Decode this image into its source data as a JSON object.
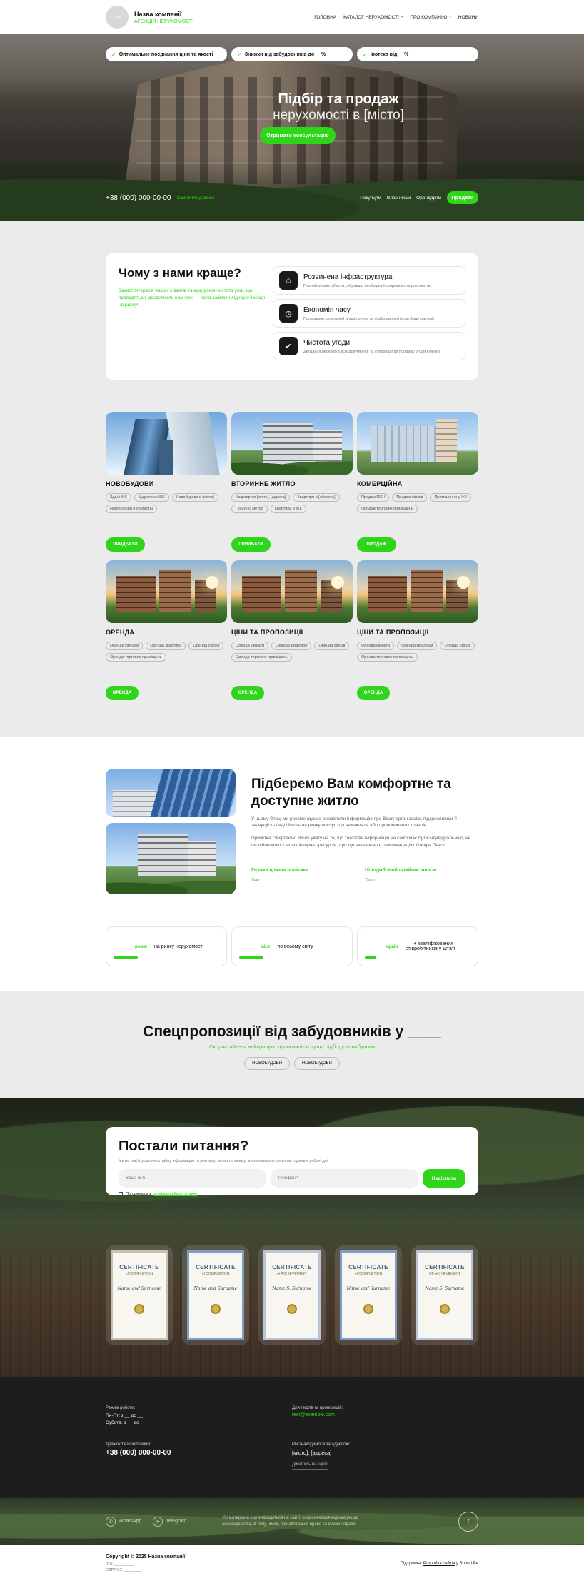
{
  "header": {
    "logo_text": "лого",
    "company": "Назва компанії",
    "subtitle": "АГЕНЦІЯ НЕРУХОМОСТІ",
    "nav": [
      {
        "label": "ГОЛОВНА",
        "chevron": false
      },
      {
        "label": "КАТАЛОГ НЕРУХОМОСТІ",
        "chevron": true
      },
      {
        "label": "ПРО КОМПАНІЮ",
        "chevron": true
      },
      {
        "label": "НОВИНИ",
        "chevron": false
      }
    ]
  },
  "hero": {
    "pills": [
      "Оптимальне поєднання ціни та якості",
      "Знижки від забудовників до __%",
      "Іпотека від __%"
    ],
    "title_line1": "Підбір та продаж",
    "title_line2": "нерухомості в [місто]",
    "cta": "Отримати консультацію",
    "phone": "+38 (000) 000-00-00",
    "order_call": "Замовити дзвінок",
    "tabs": [
      "Покупцям",
      "Власникам",
      "Орендарям"
    ],
    "sell_button": "Продати"
  },
  "why": {
    "title": "Чому з нами краще?",
    "text": "Захист інтересів наших клієнтів та юридична чистота угод, що проводяться, дозволяють нам уже __ років займати лідируючі місця на ринку!",
    "features": [
      {
        "icon": "infrastructure-icon",
        "glyph": "⌂",
        "title": "Розвинена інфраструктура",
        "desc": "Повний аналіз об'єктів, зібравши необхідну інформацію та документи"
      },
      {
        "icon": "clock-icon",
        "glyph": "◷",
        "title": "Економія часу",
        "desc": "Проводимо детальний аналіз ринку та підбір варіантів під Ваші критерії"
      },
      {
        "icon": "thumbs-up-icon",
        "glyph": "✔",
        "title": "Чистота угоди",
        "desc": "Детальна перевірка всіх документів та супровід при продажу угоди клієнтів"
      }
    ]
  },
  "catalog": [
    {
      "title": "НОВОБУДОВИ",
      "img": "sky",
      "tags": [
        "Здані ЖК",
        "Будуються ЖК",
        "Новобудови в [місто]",
        "Новобудови в [область]"
      ],
      "button": "ПРИДБАТИ"
    },
    {
      "title": "ВТОРИННЕ ЖИТЛО",
      "img": "res",
      "tags": [
        "Квартири в [місто], [адреса]",
        "Квартири в [область]",
        "Пошук із метро",
        "Квартири в ЖК"
      ],
      "button": "ПРИДБАТИ"
    },
    {
      "title": "КОМЕРЦІЙНА",
      "img": "com",
      "tags": [
        "Продаж ПСН",
        "Продаж офісів",
        "Приміщення у ЖК",
        "Продаж торгових приміщень"
      ],
      "button": "ПРОДАЖ"
    },
    {
      "title": "ОРЕНДА",
      "img": "sun",
      "tags": [
        "Оренда кімнати",
        "Оренда квартири",
        "Оренда офісів",
        "Оренда торгових приміщень"
      ],
      "button": "ОРЕНДА"
    },
    {
      "title": "ЦІНИ ТА ПРОПОЗИЦІЇ",
      "img": "sun",
      "tags": [
        "Оренда кімнати",
        "Оренда квартири",
        "Оренда офісів",
        "Оренда торгових приміщень"
      ],
      "button": "ОРЕНДА"
    },
    {
      "title": "ЦІНИ ТА ПРОПОЗИЦІЇ",
      "img": "sun",
      "tags": [
        "Оренда кімнати",
        "Оренда квартири",
        "Оренда офісів",
        "Оренда торгових приміщень"
      ],
      "button": "ОРЕНДА"
    }
  ],
  "about": {
    "title": "Підберемо Вам комфортне та доступне житло",
    "p1": "У цьому блоці ми рекомендуємо розмістити інформацію про Вашу організацію, підкресливши її значущість і надійність на ринку послуг, що надаються або пропонованих товарів.",
    "p2": "Примітка. Звертаємо Вашу увагу на те, що текстова інформація на сайті має бути індивідуальною, не скопійованою з інших інтернет-ресурсів, про що зазначено в рекомендаціях Google. Текст",
    "features": [
      {
        "title": "Гнучка цінова політика",
        "desc": "Текст"
      },
      {
        "title": "Цілодобовий прийом заявок",
        "desc": "Текст"
      }
    ],
    "stats": [
      {
        "unit": "років",
        "text": "на ринку нерухомості",
        "short": false
      },
      {
        "unit": "міст",
        "text": "по всьому світу",
        "short": false
      },
      {
        "unit": "країн",
        "text": "___+ кваліфікованих співробітників у штаті",
        "short": true
      }
    ]
  },
  "offers": {
    "title": "Спецпропозиції від забудовників у ____",
    "subtitle": "Скористайтеся найкращою пропозицією щодо підбору новобудови",
    "tabs": [
      "НОВОБУДОВИ",
      "НОВОБУДОВИ"
    ]
  },
  "question": {
    "title": "Постали питання?",
    "desc": "Ми не нав'язуємо непотрібну інформацію та рекламу, залиште заявку, ми зв'яжемося протягом години в робочі дні",
    "name_placeholder": "Ваше ім'я",
    "phone_placeholder": "Телефон *",
    "submit": "Надіслати",
    "consent_prefix": "Погоджуюся з",
    "consent_link": "конфіденційною угодою",
    "certificates": [
      {
        "line1": "CERTIFICATE",
        "line2": "of COMPLETION",
        "name": "Name and Surname",
        "style": "a"
      },
      {
        "line1": "CERTIFICATE",
        "line2": "of COMPLETION",
        "name": "Name and Surname",
        "style": "b"
      },
      {
        "line1": "CERTIFICATE",
        "line2": "of ACHIEVEMENT",
        "name": "Name S. Surname",
        "style": "c"
      },
      {
        "line1": "CERTIFICATE",
        "line2": "of COMPLETION",
        "name": "Name and Surname",
        "style": "b"
      },
      {
        "line1": "CERTIFICATE",
        "line2": "OF ACHIEVEMENT",
        "name": "Name S. Surname",
        "style": "c"
      }
    ]
  },
  "footer": {
    "hours_label": "Режим роботи:",
    "hours_1": "Пн-Пт: з __ до __",
    "hours_2": "Субота: з __ до __",
    "mail_label": "Для листів та пропозицій:",
    "email": "test@example.com",
    "call_label": "Дзвінок безкоштовний:",
    "phone": "+38 (000) 000-00-00",
    "addr_label": "Ми знаходимося за адресою:",
    "address": "[місто], [адреса]",
    "map_link": "Дивитись на карті",
    "social": [
      {
        "icon": "whatsapp-icon",
        "glyph": "✆",
        "label": "WhatsApp"
      },
      {
        "icon": "telegram-icon",
        "glyph": "➤",
        "label": "Telegram"
      }
    ],
    "note": "Усі матеріали, що знаходяться на сайті, охороняються відповідно до законодавства, в тому числі, про авторське право та суміжні права",
    "up_glyph": "↑",
    "copyright": "Copyright © 2025 Назва компанії",
    "edr_1": "ІПН: _________",
    "edr_2": "ЄДРПОУ: ________",
    "dev_prefix": "Підтримка:",
    "dev_link": "Розробка сайтів",
    "dev_suffix": "у Butterl.Pe"
  }
}
